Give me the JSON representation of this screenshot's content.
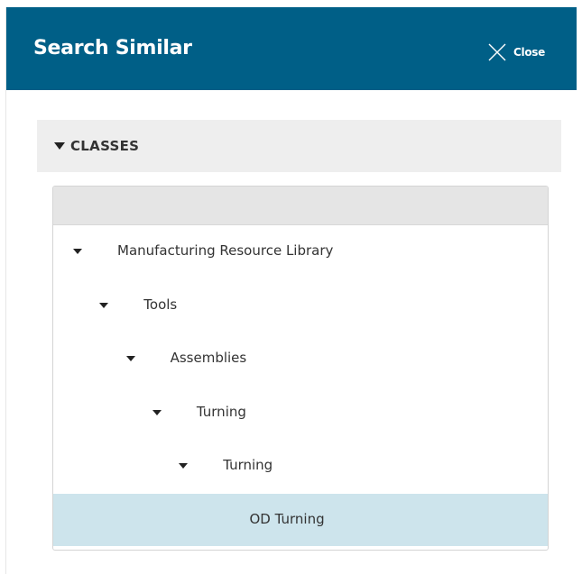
{
  "header": {
    "title": "Search Similar",
    "close_label": "Close"
  },
  "section": {
    "label": "CLASSES",
    "expanded": true
  },
  "tree": {
    "nodes": [
      {
        "label": "Manufacturing Resource Library",
        "level": 0,
        "expanded": true,
        "selected": false
      },
      {
        "label": "Tools",
        "level": 1,
        "expanded": true,
        "selected": false
      },
      {
        "label": "Assemblies",
        "level": 2,
        "expanded": true,
        "selected": false
      },
      {
        "label": "Turning",
        "level": 3,
        "expanded": true,
        "selected": false
      },
      {
        "label": "Turning",
        "level": 4,
        "expanded": true,
        "selected": false
      },
      {
        "label": "OD Turning",
        "level": 5,
        "expanded": false,
        "selected": true
      }
    ]
  },
  "colors": {
    "header_bg": "#005f87",
    "section_bg": "#eeeeee",
    "selected_row_bg": "#cde4ec"
  },
  "icons": {
    "close": "close-icon",
    "section_toggle": "caret-down-icon",
    "tree_toggle": "caret-down-icon"
  }
}
